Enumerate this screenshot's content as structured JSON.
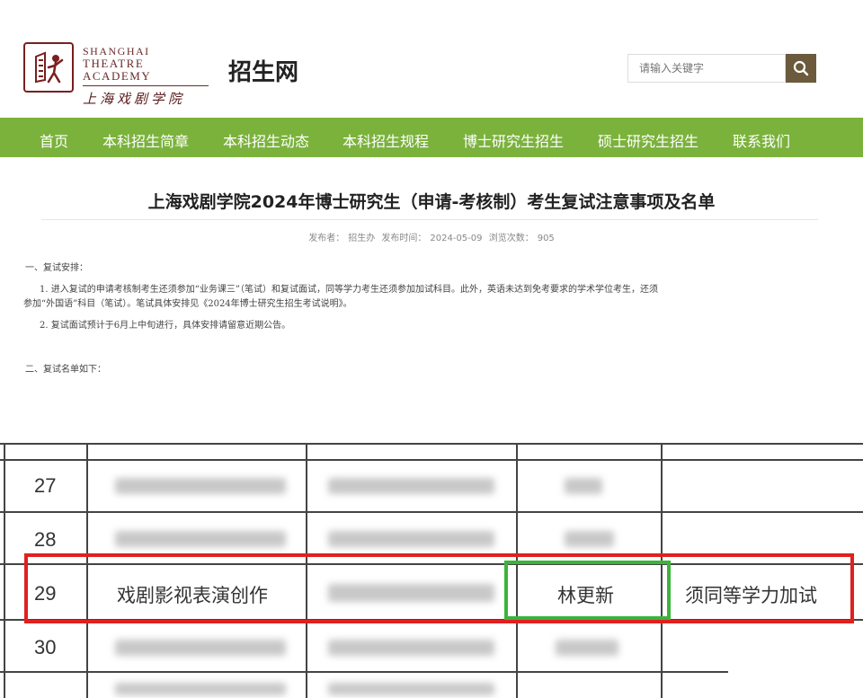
{
  "header": {
    "logo_en_line1": "SHANGHAI",
    "logo_en_line2": "THEATRE ACADEMY",
    "logo_cn": "上海戏剧学院",
    "site_name": "招生网",
    "search_placeholder": "请输入关键字"
  },
  "nav": {
    "items": [
      "首页",
      "本科招生简章",
      "本科招生动态",
      "本科招生规程",
      "博士研究生招生",
      "硕士研究生招生",
      "联系我们"
    ]
  },
  "article": {
    "title": "上海戏剧学院2024年博士研究生（申请-考核制）考生复试注意事项及名单",
    "meta": {
      "publisher_label": "发布者：",
      "publisher": "招生办",
      "time_label": "发布时间：",
      "time": "2024-05-09",
      "views_label": "浏览次数：",
      "views": "905"
    },
    "section1_heading": "一、复试安排：",
    "p1_line1": "1. 进入复试的申请考核制考生还须参加“业务课三”（笔试）和复试面试，同等学力考生还须参加加试科目。此外，英语未达到免考要求的学术学位考生，还须",
    "p1_line2": "参加“外国语”科目（笔试）。笔试具体安排见《2024年博士研究生招生考试说明》。",
    "p2": "2. 复试面试预计于6月上中旬进行，具体安排请留意近期公告。",
    "section2_heading": "二、复试名单如下："
  },
  "table": {
    "rows": [
      {
        "num": "27"
      },
      {
        "num": "28"
      },
      {
        "num": "29",
        "major": "戏剧影视表演创作",
        "name": "林更新",
        "note": "须同等学力加试"
      },
      {
        "num": "30"
      }
    ]
  },
  "colors": {
    "nav_green": "#7bb23c",
    "search_btn": "#6b5a3c",
    "highlight_red": "#e02020",
    "highlight_green": "#3ab53a"
  },
  "icons": {
    "search": "search-icon",
    "logo": "academy-logo-icon"
  }
}
